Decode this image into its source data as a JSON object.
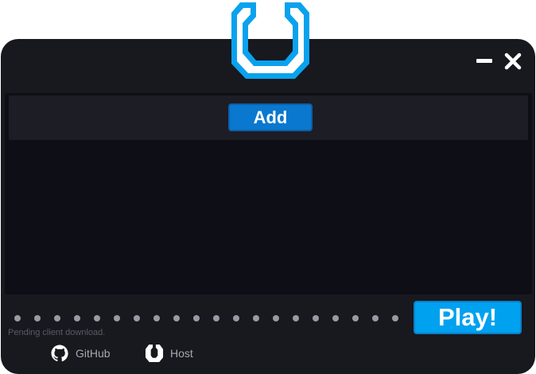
{
  "window": {
    "minimize_icon": "minimize-icon",
    "close_icon": "close-icon"
  },
  "logo": {
    "icon": "octagon-u-logo-icon",
    "color": "#0aa2ee"
  },
  "mod_list": {
    "add_label": "Add"
  },
  "footer": {
    "progress_dots": 20,
    "status_text": "Pending client download.",
    "play_label": "Play!",
    "links": [
      {
        "label": "GitHub",
        "icon": "github-icon"
      },
      {
        "label": "Host",
        "icon": "host-logo-icon"
      }
    ]
  },
  "colors": {
    "accent": "#00a1ef",
    "button": "#0a78cf",
    "background": "#18181f",
    "panel": "#0e0e16"
  }
}
